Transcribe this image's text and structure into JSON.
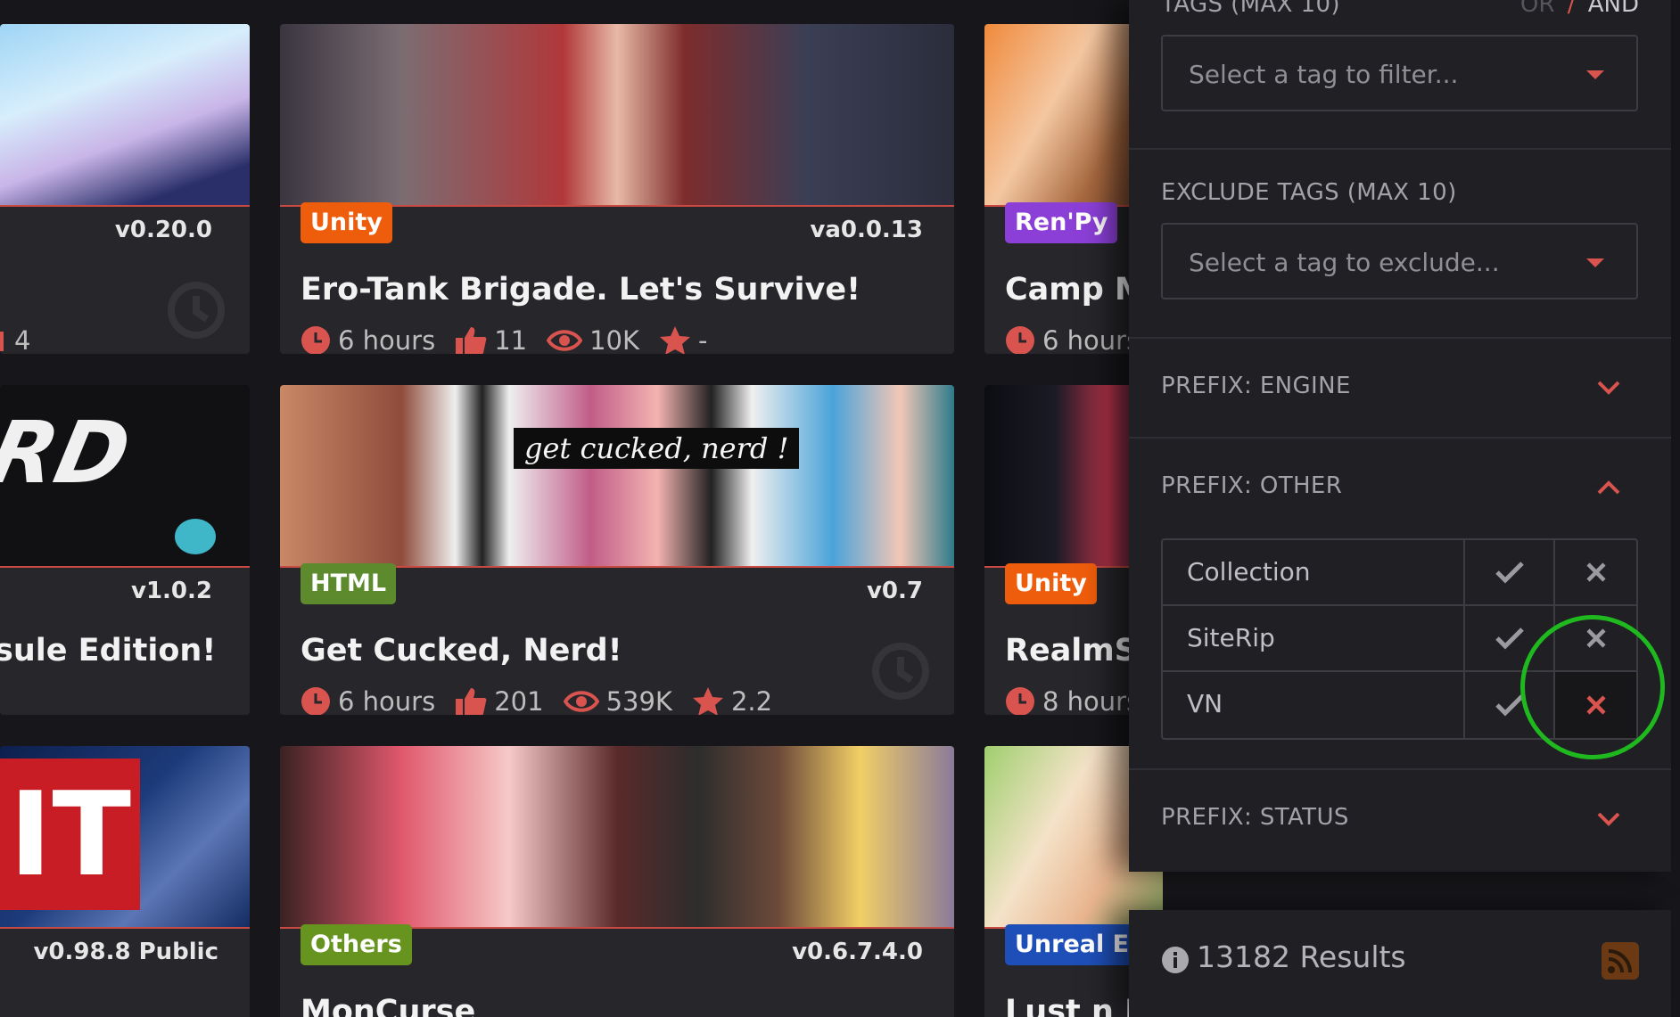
{
  "cards": [
    {
      "id": "c1",
      "badge": "",
      "version": "v0.20.0",
      "title": "",
      "stats": {
        "time": "",
        "likes": "4",
        "views": "",
        "rating": ""
      }
    },
    {
      "id": "c2",
      "badge": "Unity",
      "version": "va0.0.13",
      "title": "Ero-Tank Brigade. Let's Survive!",
      "stats": {
        "time": "6 hours",
        "likes": "11",
        "views": "10K",
        "rating": "-"
      }
    },
    {
      "id": "c3",
      "badge": "Ren'Py",
      "version": "",
      "title": "Camp M",
      "stats": {
        "time": "6 hours",
        "likes": "",
        "views": "",
        "rating": ""
      }
    },
    {
      "id": "c4",
      "badge": "",
      "version": "v1.0.2",
      "title": "sule Edition!",
      "stats": {
        "time": "",
        "likes": "",
        "views": "",
        "rating": ""
      }
    },
    {
      "id": "c5",
      "badge": "HTML",
      "version": "v0.7",
      "title": "Get Cucked, Nerd!",
      "stats": {
        "time": "6 hours",
        "likes": "201",
        "views": "539K",
        "rating": "2.2"
      }
    },
    {
      "id": "c6",
      "badge": "Unity",
      "version": "",
      "title": "RealmS",
      "stats": {
        "time": "8 hours",
        "likes": "",
        "views": "",
        "rating": ""
      }
    },
    {
      "id": "c7",
      "badge": "",
      "version": "v0.98.8 Public",
      "title": "",
      "stats": {
        "time": "",
        "likes": "",
        "views": "",
        "rating": ""
      }
    },
    {
      "id": "c8",
      "badge": "Others",
      "version": "v0.6.7.4.0",
      "title": "MonCurse",
      "stats": {
        "time": "",
        "likes": "",
        "views": "",
        "rating": ""
      }
    },
    {
      "id": "c9",
      "badge": "Unreal En",
      "version": "",
      "title": "Lust n F",
      "stats": {
        "time": "",
        "likes": "",
        "views": "",
        "rating": ""
      }
    }
  ],
  "thumb_texts": {
    "c4": "RD",
    "c5": "get cucked, nerd !",
    "c7": "IT"
  },
  "badge_colors": {
    "Unity": "#ee5d0c",
    "Ren'Py": "#8b3fd6",
    "HTML": "#5c8a2d",
    "Others": "#67941e",
    "Unreal En": "#1e4fb8"
  },
  "filters": {
    "tags": {
      "label": "TAGS (MAX 10)",
      "mode_or": "OR",
      "mode_sep": "/",
      "mode_and": "AND",
      "placeholder": "Select a tag to filter..."
    },
    "exclude": {
      "label": "EXCLUDE TAGS (MAX 10)",
      "placeholder": "Select a tag to exclude..."
    },
    "prefix_engine": {
      "label": "PREFIX: ENGINE",
      "expanded": false
    },
    "prefix_other": {
      "label": "PREFIX: OTHER",
      "expanded": true,
      "items": [
        {
          "label": "Collection",
          "state": "none"
        },
        {
          "label": "SiteRip",
          "state": "none"
        },
        {
          "label": "VN",
          "state": "excluded"
        }
      ]
    },
    "prefix_status": {
      "label": "PREFIX: STATUS",
      "expanded": false
    }
  },
  "results": {
    "text": "13182 Results"
  },
  "colors": {
    "accent": "#d9534f",
    "background": "#17171b",
    "card": "#26262b",
    "panel": "#1f1f24",
    "annotation": "#1fb81f"
  }
}
